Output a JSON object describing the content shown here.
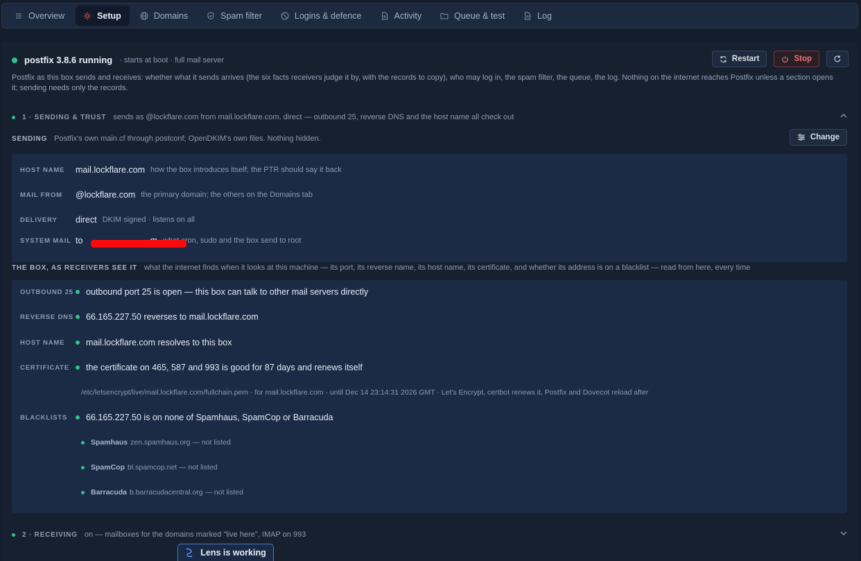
{
  "nav": {
    "tabs": [
      {
        "label": "Overview",
        "icon": "list-icon",
        "active": false
      },
      {
        "label": "Setup",
        "icon": "sun-icon",
        "active": true
      },
      {
        "label": "Domains",
        "icon": "globe-icon",
        "active": false
      },
      {
        "label": "Spam filter",
        "icon": "shield-icon",
        "active": false
      },
      {
        "label": "Logins & defence",
        "icon": "ban-icon",
        "active": false
      },
      {
        "label": "Activity",
        "icon": "document-icon",
        "active": false
      },
      {
        "label": "Queue & test",
        "icon": "folder-icon",
        "active": false
      },
      {
        "label": "Log",
        "icon": "document-icon",
        "active": false
      }
    ]
  },
  "service": {
    "title": "postfix 3.8.6 running",
    "subtitle": "· starts at boot · full mail server",
    "status_color": "#2fc48a",
    "restart_label": "Restart",
    "stop_label": "Stop",
    "intro": "Postfix as this box sends and receives: whether what it sends arrives (the six facts receivers judge it by, with the records to copy), who may log in, the spam filter, the queue, the log. Nothing on the internet reaches Postfix unless a section opens it; sending needs only the records."
  },
  "section1": {
    "number": "1 · SENDING & TRUST",
    "desc": "sends as @lockflare.com from mail.lockflare.com, direct — outbound 25, reverse DNS and the host name all check out",
    "sending": {
      "label": "SENDING",
      "desc": "Postfix's own main.cf through postconf; OpenDKIM's own files. Nothing hidden.",
      "change_label": "Change",
      "rows": [
        {
          "label": "HOST NAME",
          "value": "mail.lockflare.com",
          "note": "how the box introduces itself; the PTR should say it back"
        },
        {
          "label": "MAIL FROM",
          "value": "@lockflare.com",
          "note": "the primary domain; the others on the Domains tab"
        },
        {
          "label": "DELIVERY",
          "value": "direct",
          "note": "DKIM signed · listens on all"
        },
        {
          "label": "SYSTEM MAIL",
          "value": "to                            m",
          "note": "what cron, sudo and the box send to root"
        }
      ]
    },
    "box": {
      "label": "THE BOX, AS RECEIVERS SEE IT",
      "desc": "what the internet finds when it looks at this machine — its port, its reverse name, its host name, its certificate, and whether its address is on a blacklist — read from here, every time",
      "checks": [
        {
          "label": "OUTBOUND 25",
          "text": "outbound port 25 is open — this box can talk to other mail servers directly"
        },
        {
          "label": "REVERSE DNS",
          "text": "66.165.227.50 reverses to mail.lockflare.com"
        },
        {
          "label": "HOST NAME",
          "text": "mail.lockflare.com resolves to this box"
        },
        {
          "label": "CERTIFICATE",
          "text": "the certificate on 465, 587 and 993 is good for 87 days and renews itself"
        },
        {
          "label": "BLACKLISTS",
          "text": "66.165.227.50 is on none of Spamhaus, SpamCop or Barracuda"
        }
      ],
      "cert_detail": "/etc/letsencrypt/live/mail.lockflare.com/fullchain.pem · for mail.lockflare.com · until Dec 14 23:14:31 2026 GMT · Let's Encrypt, certbot renews it, Postfix and Dovecot reload after",
      "blacklists": [
        {
          "name": "Spamhaus",
          "detail": "zen.spamhaus.org — not listed"
        },
        {
          "name": "SpamCop",
          "detail": "bl.spamcop.net — not listed"
        },
        {
          "name": "Barracuda",
          "detail": "b.barracudacentral.org — not listed"
        }
      ]
    }
  },
  "section2": {
    "number": "2 · RECEIVING",
    "desc": "on — mailboxes for the domains marked \"live here\", IMAP on 993"
  },
  "lens": {
    "label": "Lens is working"
  }
}
